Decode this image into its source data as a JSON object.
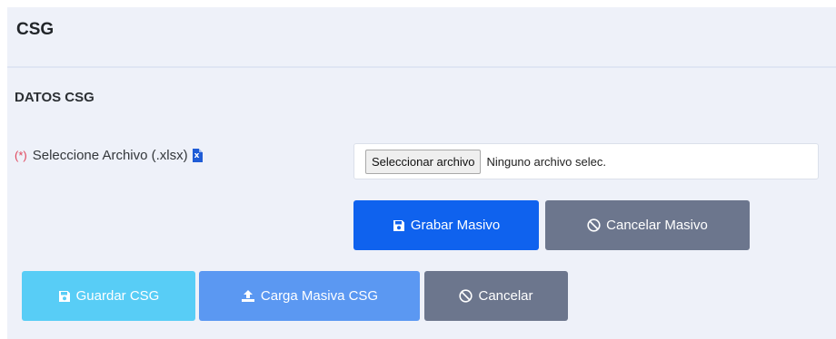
{
  "card": {
    "title": "CSG",
    "section_title": "DATOS CSG"
  },
  "form": {
    "required_mark": "(*)",
    "file_label": "Seleccione Archivo (.xlsx)",
    "file_icon": "file-excel-icon",
    "file_button": "Seleccionar archivo",
    "file_status": "Ninguno archivo selec."
  },
  "buttons": {
    "grabar_masivo": "Grabar Masivo",
    "cancelar_masivo": "Cancelar Masivo",
    "guardar_csg": "Guardar CSG",
    "carga_masiva_csg": "Carga Masiva CSG",
    "cancelar": "Cancelar"
  },
  "colors": {
    "primary": "#0f62ee",
    "gray": "#6c768d",
    "info": "#58cdf6",
    "blue_light": "#5b98f2",
    "card_bg": "#eef1f9",
    "required": "#e0445a"
  }
}
